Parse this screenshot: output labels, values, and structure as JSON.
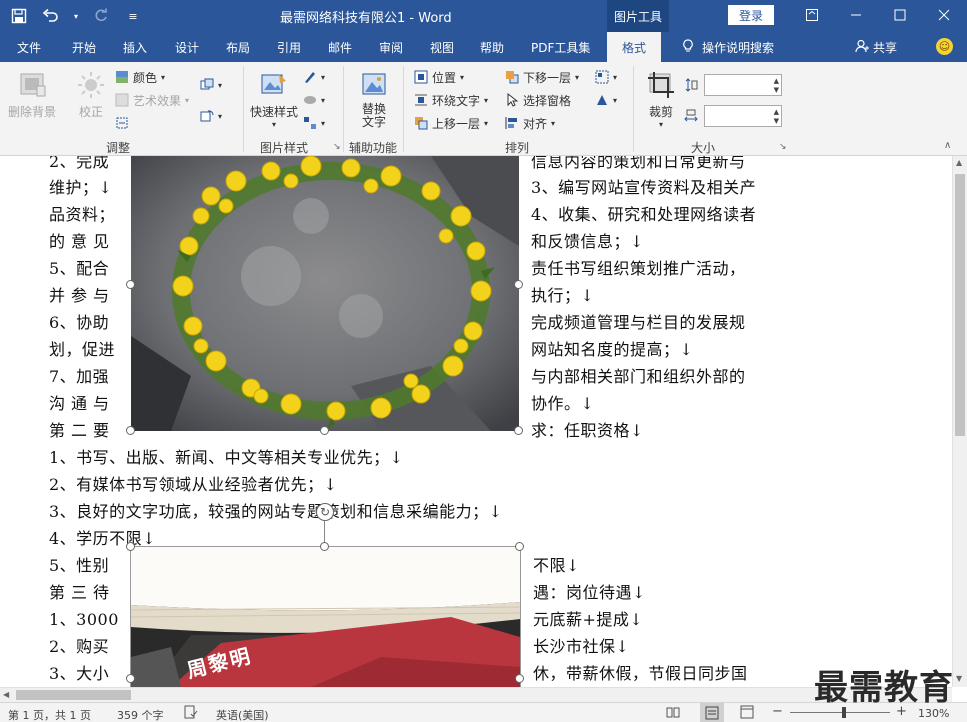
{
  "title": "最需网络科技有限公1 - Word",
  "context_tab": "图片工具",
  "login": "登录",
  "tabs": [
    "文件",
    "开始",
    "插入",
    "设计",
    "布局",
    "引用",
    "邮件",
    "审阅",
    "视图",
    "帮助",
    "PDF工具集",
    "格式"
  ],
  "search": "操作说明搜索",
  "share": "共享",
  "ribbon": {
    "remove_bg": "删除背景",
    "correct": "校正",
    "color": "颜色",
    "art_effects": "艺术效果",
    "group_adjust": "调整",
    "quick_styles": "快速样式",
    "group_pic_styles": "图片样式",
    "alt_text": "替换文字",
    "group_accessibility": "辅助功能",
    "position": "位置",
    "wrap_text": "环绕文字",
    "bring_forward": "上移一层",
    "send_backward": "下移一层",
    "selection_pane": "选择窗格",
    "align": "对齐",
    "group_arrange": "排列",
    "crop": "裁剪",
    "group_size": "大小"
  },
  "doc": {
    "left_col": [
      "2、完成",
      "维护；↓",
      "品资料；",
      "的意见",
      "5、配合",
      "并参与",
      "6、协助",
      "划，促进",
      "7、加强",
      "沟通与",
      "第二要"
    ],
    "right_col": [
      "信息内容的策划和日常更新与",
      "3、编写网站宣传资料及相关产",
      "4、收集、研究和处理网络读者",
      "和反馈信息；↓",
      "责任书写组织策划推广活动，",
      "执行；↓",
      "完成频道管理与栏目的发展规",
      "网站知名度的提高；↓",
      "与内部相关部门和组织外部的",
      "协作。↓",
      "求：任职资格↓"
    ],
    "full_lines": [
      "1、书写、出版、新闻、中文等相关专业优先；↓",
      "2、有媒体书写领域从业经验者优先；↓",
      "3、良好的文字功底，较强的网站专题策划和信息采编能力；↓",
      "4、学历不限↓"
    ],
    "left_col2": [
      "5、性别",
      "第三待",
      "1、3000",
      "2、购买",
      "3、大小"
    ],
    "right_col2": [
      "不限↓",
      "遇：岗位待遇↓",
      "元底薪+提成↓",
      "长沙市社保↓",
      "休，带薪休假，节假日同步国"
    ],
    "img2_text": "周黎明"
  },
  "status": {
    "page": "第 1 页，共 1 页",
    "words": "359 个字",
    "lang": "英语(美国)",
    "zoom": "130%"
  },
  "watermark": "最需教育",
  "colors": {
    "accent": "#2b579a",
    "ribbon_bg": "#f3f3f3"
  }
}
